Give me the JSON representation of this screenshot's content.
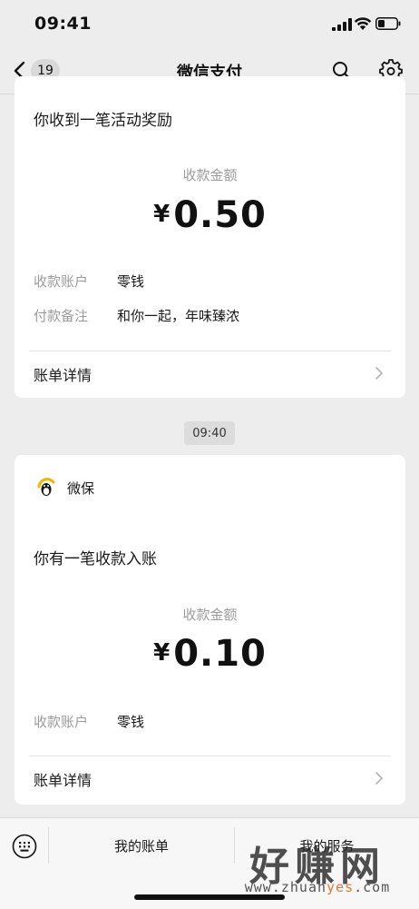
{
  "status_bar": {
    "time": "09:41"
  },
  "nav": {
    "back_badge": "19",
    "title": "微信支付"
  },
  "card1": {
    "heading": "你收到一笔活动奖励",
    "amount_label": "收款金额",
    "currency": "¥",
    "amount": "0.50",
    "rows": [
      {
        "label": "收款账户",
        "value": "零钱"
      },
      {
        "label": "付款备注",
        "value": "和你一起，年味臻浓"
      }
    ],
    "details_label": "账单详情"
  },
  "timestamp": "09:40",
  "card2": {
    "service_name": "微保",
    "heading": "你有一笔收款入账",
    "amount_label": "收款金额",
    "currency": "¥",
    "amount": "0.10",
    "rows": [
      {
        "label": "收款账户",
        "value": "零钱"
      }
    ],
    "details_label": "账单详情"
  },
  "bottom_menu": {
    "items": [
      {
        "label": "我的账单"
      },
      {
        "label": "我的服务"
      }
    ]
  },
  "watermark": {
    "main": "好赚网",
    "sub_prefix": "www.zhuan",
    "sub_accent": "yes",
    "sub_suffix": ".com"
  },
  "icons": {
    "back": "chevron-left-icon",
    "search": "search-icon",
    "settings": "gear-icon",
    "details": "chevron-right-icon",
    "keyboard": "keyboard-icon",
    "service": "weibao-logo-icon"
  },
  "colors": {
    "background": "#ededed",
    "card": "#ffffff",
    "muted_text": "#9b9b9b",
    "accent": "#e8742a"
  }
}
